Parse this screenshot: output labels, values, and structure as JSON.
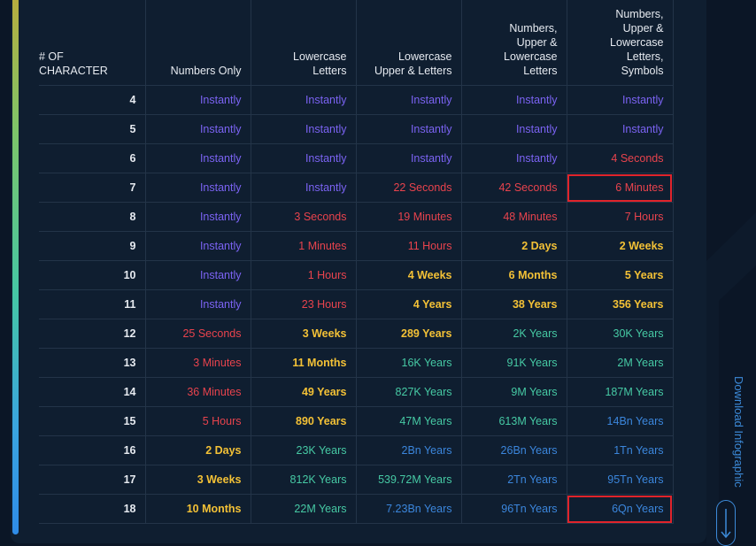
{
  "table": {
    "headers": [
      [
        "# OF",
        "CHARACTER"
      ],
      [
        "Numbers Only"
      ],
      [
        "Lowercase",
        "Letters"
      ],
      [
        "Lowercase",
        "Upper & Letters"
      ],
      [
        "Numbers,",
        "Upper &",
        "Lowercase",
        "Letters"
      ],
      [
        "Numbers,",
        "Upper &",
        "Lowercase",
        "Letters,",
        "Symbols"
      ]
    ],
    "rows": [
      {
        "n": "4",
        "cells": [
          "Instantly",
          "Instantly",
          "Instantly",
          "Instantly",
          "Instantly"
        ],
        "colors": [
          "instant",
          "instant",
          "instant",
          "instant",
          "instant"
        ]
      },
      {
        "n": "5",
        "cells": [
          "Instantly",
          "Instantly",
          "Instantly",
          "Instantly",
          "Instantly"
        ],
        "colors": [
          "instant",
          "instant",
          "instant",
          "instant",
          "instant"
        ]
      },
      {
        "n": "6",
        "cells": [
          "Instantly",
          "Instantly",
          "Instantly",
          "Instantly",
          "4 Seconds"
        ],
        "colors": [
          "instant",
          "instant",
          "instant",
          "instant",
          "red"
        ]
      },
      {
        "n": "7",
        "cells": [
          "Instantly",
          "Instantly",
          "22 Seconds",
          "42 Seconds",
          "6 Minutes"
        ],
        "colors": [
          "instant",
          "instant",
          "red",
          "red",
          "red"
        ]
      },
      {
        "n": "8",
        "cells": [
          "Instantly",
          "3 Seconds",
          "19 Minutes",
          "48 Minutes",
          "7 Hours"
        ],
        "colors": [
          "instant",
          "red",
          "red",
          "red",
          "red"
        ]
      },
      {
        "n": "9",
        "cells": [
          "Instantly",
          "1 Minutes",
          "11 Hours",
          "2 Days",
          "2 Weeks"
        ],
        "colors": [
          "instant",
          "red",
          "red",
          "yellow",
          "yellow"
        ]
      },
      {
        "n": "10",
        "cells": [
          "Instantly",
          "1 Hours",
          "4 Weeks",
          "6 Months",
          "5 Years"
        ],
        "colors": [
          "instant",
          "red",
          "yellow",
          "yellow",
          "yellow"
        ]
      },
      {
        "n": "11",
        "cells": [
          "Instantly",
          "23 Hours",
          "4 Years",
          "38 Years",
          "356 Years"
        ],
        "colors": [
          "instant",
          "red",
          "yellow",
          "yellow",
          "yellow"
        ]
      },
      {
        "n": "12",
        "cells": [
          "25 Seconds",
          "3 Weeks",
          "289 Years",
          "2K Years",
          "30K Years"
        ],
        "colors": [
          "red",
          "yellow",
          "yellow",
          "teal",
          "teal"
        ]
      },
      {
        "n": "13",
        "cells": [
          "3 Minutes",
          "11 Months",
          "16K Years",
          "91K Years",
          "2M Years"
        ],
        "colors": [
          "red",
          "yellow",
          "teal",
          "teal",
          "teal"
        ]
      },
      {
        "n": "14",
        "cells": [
          "36 Minutes",
          "49 Years",
          "827K Years",
          "9M Years",
          "187M Years"
        ],
        "colors": [
          "red",
          "yellow",
          "teal",
          "teal",
          "teal"
        ]
      },
      {
        "n": "15",
        "cells": [
          "5 Hours",
          "890 Years",
          "47M Years",
          "613M Years",
          "14Bn Years"
        ],
        "colors": [
          "red",
          "yellow",
          "teal",
          "teal",
          "blue"
        ]
      },
      {
        "n": "16",
        "cells": [
          "2 Days",
          "23K Years",
          "2Bn Years",
          "26Bn Years",
          "1Tn Years"
        ],
        "colors": [
          "yellow",
          "teal",
          "blue",
          "blue",
          "blue"
        ]
      },
      {
        "n": "17",
        "cells": [
          "3 Weeks",
          "812K Years",
          "539.72M Years",
          "2Tn Years",
          "95Tn Years"
        ],
        "colors": [
          "yellow",
          "teal",
          "teal",
          "blue",
          "blue"
        ]
      },
      {
        "n": "18",
        "cells": [
          "10 Months",
          "22M Years",
          "7.23Bn Years",
          "96Tn Years",
          "6Qn Years"
        ],
        "colors": [
          "yellow",
          "teal",
          "blue",
          "blue",
          "blue"
        ]
      }
    ],
    "highlighted": [
      [
        3,
        4
      ],
      [
        14,
        4
      ]
    ]
  },
  "colors": {
    "instant": "#7b63f3",
    "red": "#e8434d",
    "yellow": "#f3c136",
    "teal": "#46c9a4",
    "blue": "#3b86dc",
    "highlight": "#e0242b"
  },
  "download": {
    "label": "Download Infographic",
    "icon": "arrow-down-icon"
  }
}
